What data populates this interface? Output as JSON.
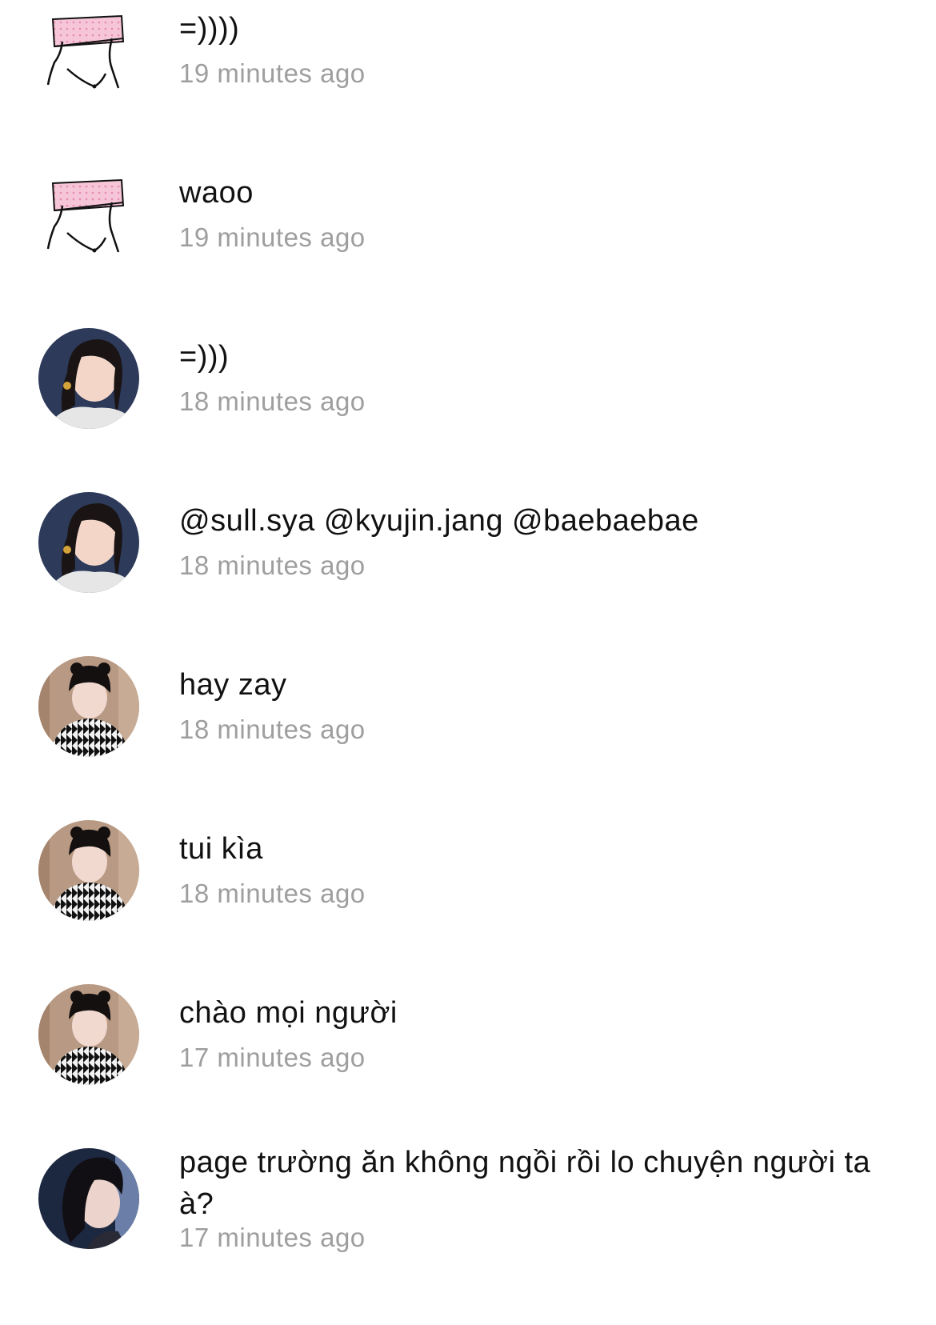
{
  "comments": [
    {
      "avatar_icon": "pink-hat-face-sticker-icon",
      "text": "=))))",
      "time": "19 minutes ago"
    },
    {
      "avatar_icon": "pink-hat-face-sticker-icon",
      "text": "waoo",
      "time": "19 minutes ago"
    },
    {
      "avatar_icon": "profile-photo-icon",
      "text": "=)))",
      "time": "18 minutes ago"
    },
    {
      "avatar_icon": "profile-photo-icon",
      "text": "@sull.sya @kyujin.jang @baebaebae",
      "time": "18 minutes ago"
    },
    {
      "avatar_icon": "profile-photo-icon",
      "text": "hay zay",
      "time": "18 minutes ago"
    },
    {
      "avatar_icon": "profile-photo-icon",
      "text": "tui kìa",
      "time": "18 minutes ago"
    },
    {
      "avatar_icon": "profile-photo-icon",
      "text": "chào mọi người",
      "time": "17 minutes ago"
    },
    {
      "avatar_icon": "profile-photo-icon",
      "text": "page trường ăn không ngồi rồi lo chuyện người ta à?",
      "time": "17 minutes ago"
    }
  ],
  "colors": {
    "text": "#111111",
    "timestamp": "#9e9e9e",
    "sticker_pink": "#f6c6d8"
  }
}
